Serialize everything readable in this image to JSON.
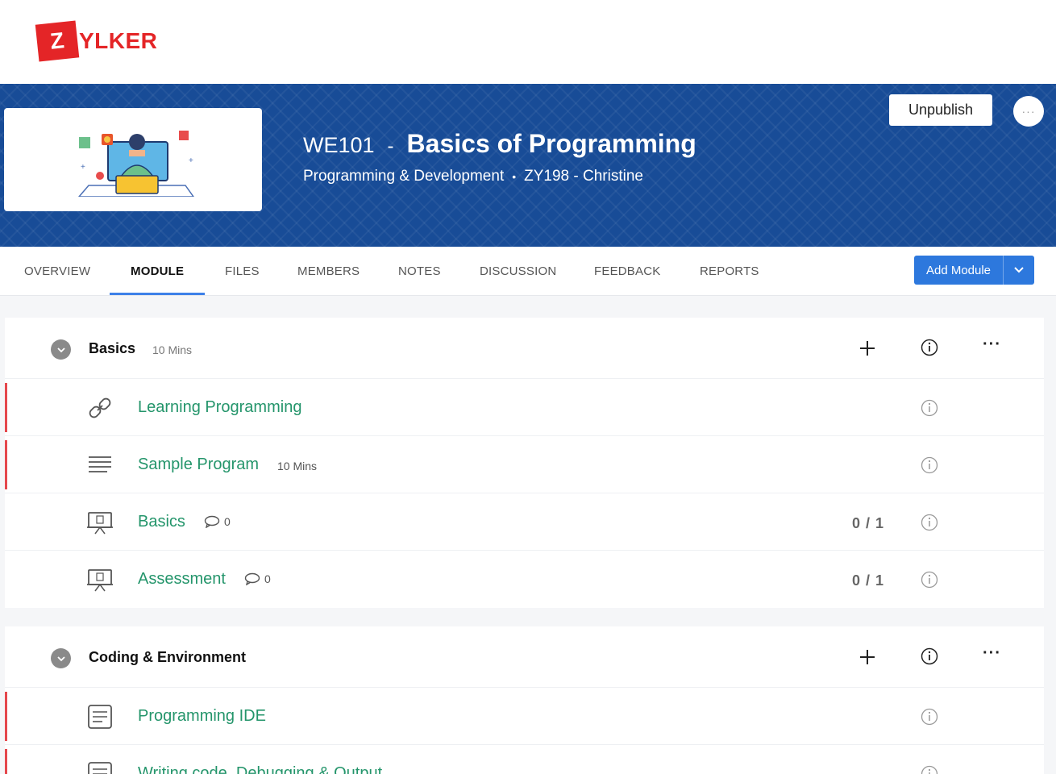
{
  "brand": {
    "logo_letter": "Z",
    "logo_text": "YLKER",
    "color": "#e42527"
  },
  "course": {
    "code": "WE101",
    "separator": "-",
    "title": "Basics of Programming",
    "category": "Programming & Development",
    "dot": "•",
    "instructor": "ZY198 - Christine",
    "unpublish_label": "Unpublish",
    "more_label": "···",
    "banner_color": "#184c97"
  },
  "tabs": [
    {
      "label": "OVERVIEW"
    },
    {
      "label": "MODULE",
      "active": true
    },
    {
      "label": "FILES"
    },
    {
      "label": "MEMBERS"
    },
    {
      "label": "NOTES"
    },
    {
      "label": "DISCUSSION"
    },
    {
      "label": "FEEDBACK"
    },
    {
      "label": "REPORTS"
    }
  ],
  "add_module": {
    "label": "Add Module",
    "color": "#2d78dd"
  },
  "modules": [
    {
      "title": "Basics",
      "duration": "10 Mins",
      "items": [
        {
          "icon": "link-icon",
          "label": "Learning Programming",
          "marked": true
        },
        {
          "icon": "text-lines-icon",
          "label": "Sample Program",
          "duration": "10 Mins",
          "marked": true
        },
        {
          "icon": "presentation-icon",
          "label": "Basics",
          "comments": "0",
          "score": "0 / 1"
        },
        {
          "icon": "presentation-icon",
          "label": "Assessment",
          "comments": "0",
          "score": "0 / 1"
        }
      ]
    },
    {
      "title": "Coding & Environment",
      "items": [
        {
          "icon": "document-icon",
          "label": "Programming IDE",
          "marked": true
        },
        {
          "icon": "document-icon",
          "label": "Writing code, Debugging & Output",
          "marked": true
        }
      ]
    }
  ],
  "colors": {
    "item_text": "#24956b",
    "marker": "#e5484d",
    "tab_active": "#3d80e8"
  }
}
